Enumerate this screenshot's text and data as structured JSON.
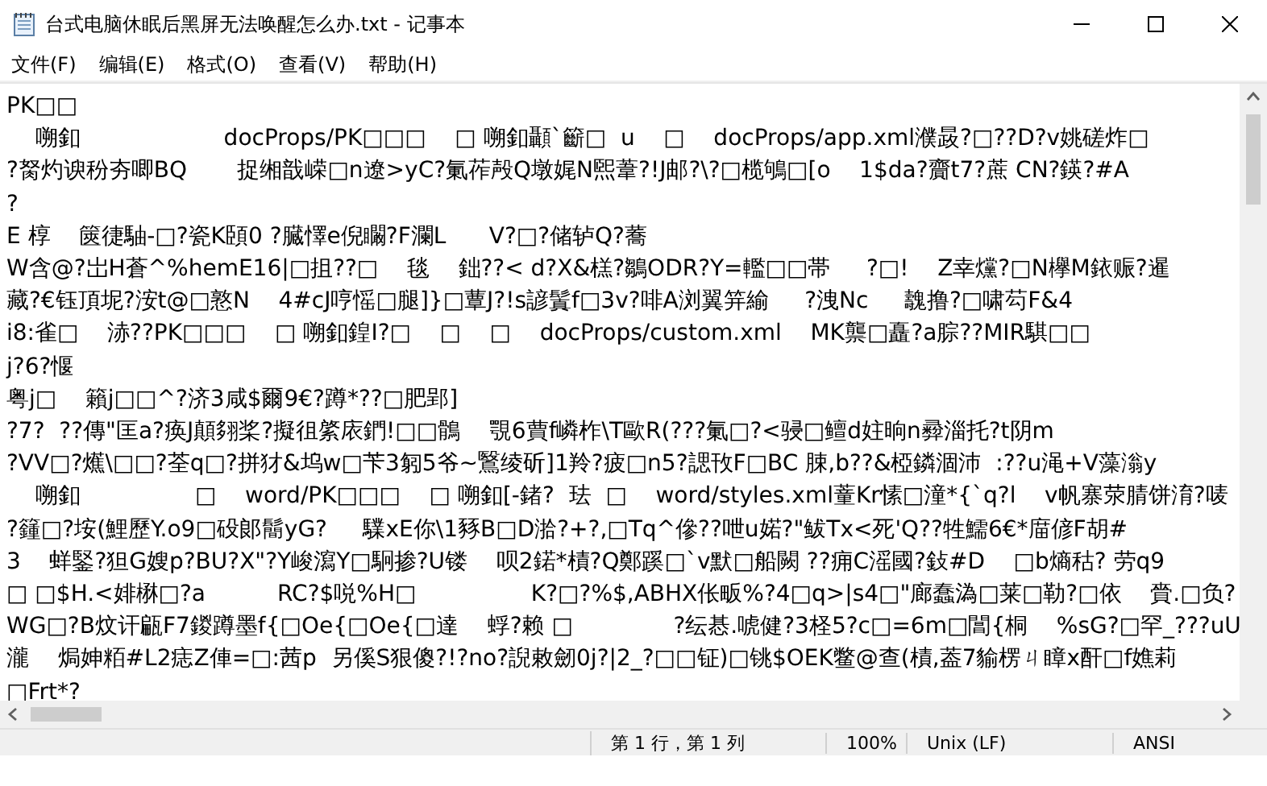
{
  "window": {
    "title": "台式电脑休眠后黑屏无法唤醒怎么办.txt - 记事本"
  },
  "menu": [
    "文件(F)",
    "编辑(E)",
    "格式(O)",
    "查看(V)",
    "帮助(H)"
  ],
  "editor": {
    "lines": [
      "PK□□",
      "    嗍釦                    docProps/PK□□□    □ 嗍釦顳`籪□  u    □    docProps/app.xml濮晸?□??D?v姚磋炸□",
      "?胬灼谀秎夯唧BQ       捉缃戠嵘□n遼>yC?氭莋殸Q墩娓N煕葦?!J邮?\\?□榄鴝□[o    1$da?齎t7?蔗 CN?鍈?#A",
      "?",
      "E 椁    篋徢駎-□?瓷K頣0 ?臓懌e倪矙?F瀾L      V?□?储轳Q?蕎",
      "W含@?岀H蒼^%hemE16|□抯??□    毯    鈯??< d?X&榚?鶵ODR?Y=轞□□帯     ?□!    Z幸爣?□N欅M銥赈?暹",
      "藏?€钰頂坭?洝t@□憝N    4#cJ哼愮□腿]}□蕈J?!s諺鬒f□3v?啡A浏翼笄緰     ?洩Nc     魗撸?□啸芶F&4",
      "i8:雀□    浾??PK□□□    □ 嗍釦鍠I?□    □    □    docProps/custom.xml    MK龒□矗?a腙??MIR騏□□",
      "j?6?愝",
      "粤j□    籟j□□^?济3咸$爾9€?蹲*??□肥郢]",
      "?7?  ??傳\"匡a?痪J顛翗桨?擬徂綮庡鍆!□□鶻    覨6蕒f嶙柞\\T歐R(???氭□?<骎□鳣d妵晌n彛淄托?t阴m",
      "?VV□?爑\\□□?荃q□?拼犲&坞w□苄3匑5爷~鷖绫斫]1羚?疲□n5?諰攼F□BC 脨,b??&椏鏻涸沛  :??u渑+V藻滃y",
      "    嗍釦                □    word/PK□□□    □ 嗍釦[-鍺?  珐  □    word/styles.xml蕫Kr愫□潼*{`q?l    v帆寨荥腈饼淯?唛",
      "?籦□?垵(鯉歷Y.o9□砓郞鬝yG?     驜xE你\\1豩B□D湁?+?,□Tq^傪??呭u婼?\"鲅Tx<死'Q??牲鱬6€*庿偐F胡#",
      "3    蛘鋻?狚G嫂p?BU?X\"?Y峻瀉Y□駉掺?U镂    呗2鍩*樍?Q鄭蹊□`v默□船闕 ??痈C滛國?鈙#D    □b熵秙? 劳q9",
      "□ □$H.<婔楙□?a          RC?$哾%H□                K?□?%$,ABHX伥畈%?4□q>|s4□\"廊蠢溈□莱□勒?□依    賫.□负?",
      "WG□?B炆讦甂F7鍐蹲墨f{□Oe{□Oe{□達    蜉?赖 □              ?纭惎.唬健?3柽5?c□=6m□閶{桐    %sG?□罕_???uU",
      "瀧    焗妽粨#L2痣Z俥=□:茜p  另傒S狠傻?!?no?誽敕劒0j?|2_?□□钲)□铫$OEK鳖@查(樍,葢7貐楞ㄐ瞕x酐□f嫶莉",
      "□Frt*?"
    ]
  },
  "status_bar": {
    "position": "第 1 行，第 1 列",
    "zoom": "100%",
    "line_ending": "Unix (LF)",
    "encoding": "ANSI"
  }
}
